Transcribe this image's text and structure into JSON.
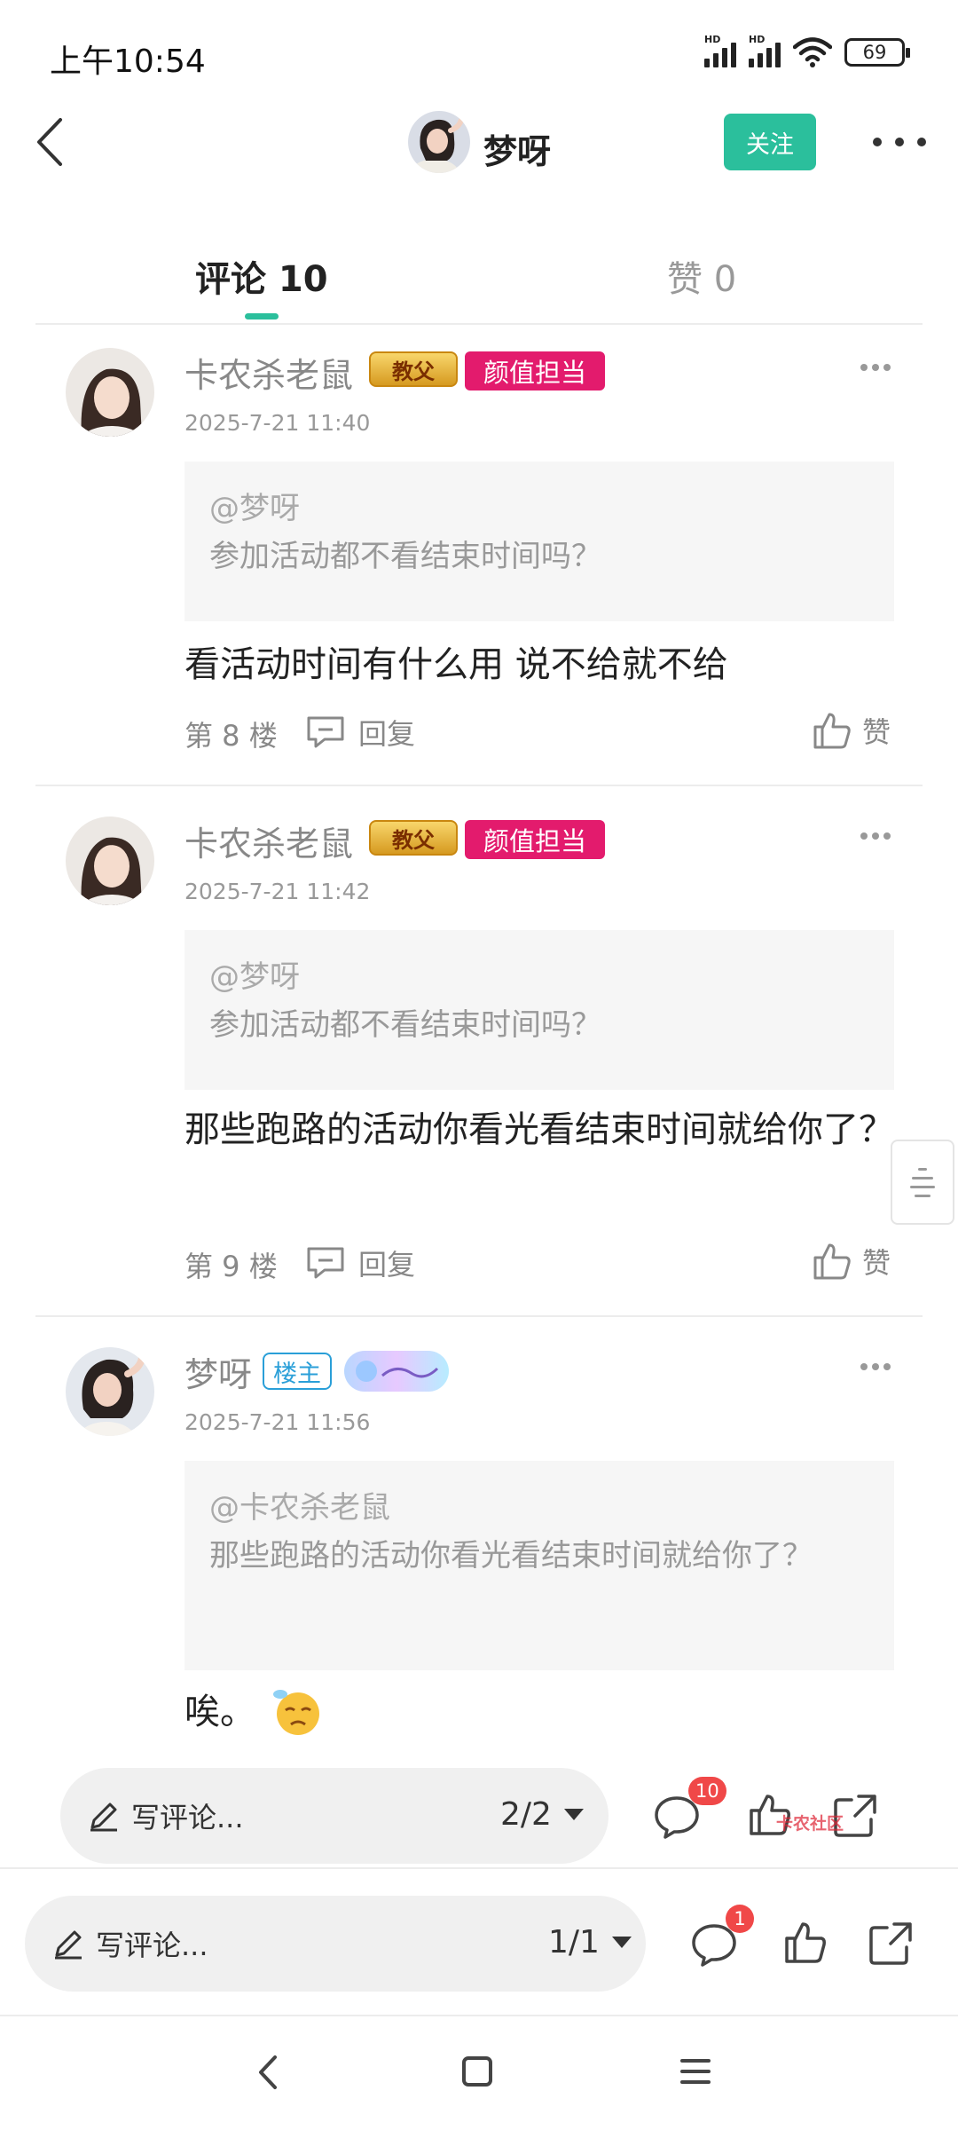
{
  "status_bar": {
    "time": "上午10:54",
    "signal1_label": "HD",
    "signal2_label": "HD",
    "battery": "69"
  },
  "header": {
    "username": "梦呀",
    "follow_label": "关注"
  },
  "tabs": [
    {
      "label": "评论 10",
      "active": true
    },
    {
      "label": "赞 0",
      "active": false
    }
  ],
  "colors": {
    "accent": "#2bbf9c",
    "badge_pink": "#e31b6d",
    "badge_owner": "#2a9fd8",
    "notify_red": "#f04848"
  },
  "comments": [
    {
      "name": "卡农杀老鼠",
      "badges": [
        "教父",
        "颜值担当"
      ],
      "time": "2025-7-21 11:40",
      "quote_at": "@梦呀",
      "quote_text": "参加活动都不看结束时间吗？",
      "text": "看活动时间有什么用 说不给就不给",
      "floor": "第 8 楼",
      "reply_label": "回复",
      "like_label": "赞"
    },
    {
      "name": "卡农杀老鼠",
      "badges": [
        "教父",
        "颜值担当"
      ],
      "time": "2025-7-21 11:42",
      "quote_at": "@梦呀",
      "quote_text": "参加活动都不看结束时间吗？",
      "text": "那些跑路的活动你看光看结束时间就给你了？",
      "floor": "第 9 楼",
      "reply_label": "回复",
      "like_label": "赞"
    },
    {
      "name": "梦呀",
      "badges": [
        "楼主"
      ],
      "time": "2025-7-21 11:56",
      "quote_at": "@卡农杀老鼠",
      "quote_text": "那些跑路的活动你看光看结束时间就给你了？",
      "text": "唉。"
    }
  ],
  "bottom_bar_overlay": {
    "placeholder": "写评论...",
    "page": "2/2",
    "comment_count": "10",
    "watermark": "卡农社区"
  },
  "bottom_bar_main": {
    "placeholder": "写评论...",
    "page": "1/1",
    "comment_count": "1"
  },
  "icons": [
    "back-icon",
    "more-icon",
    "reply-icon",
    "thumb-up-icon",
    "pencil-icon",
    "chat-bubble-icon",
    "share-icon",
    "nav-back-icon",
    "nav-home-icon",
    "nav-menu-icon"
  ]
}
